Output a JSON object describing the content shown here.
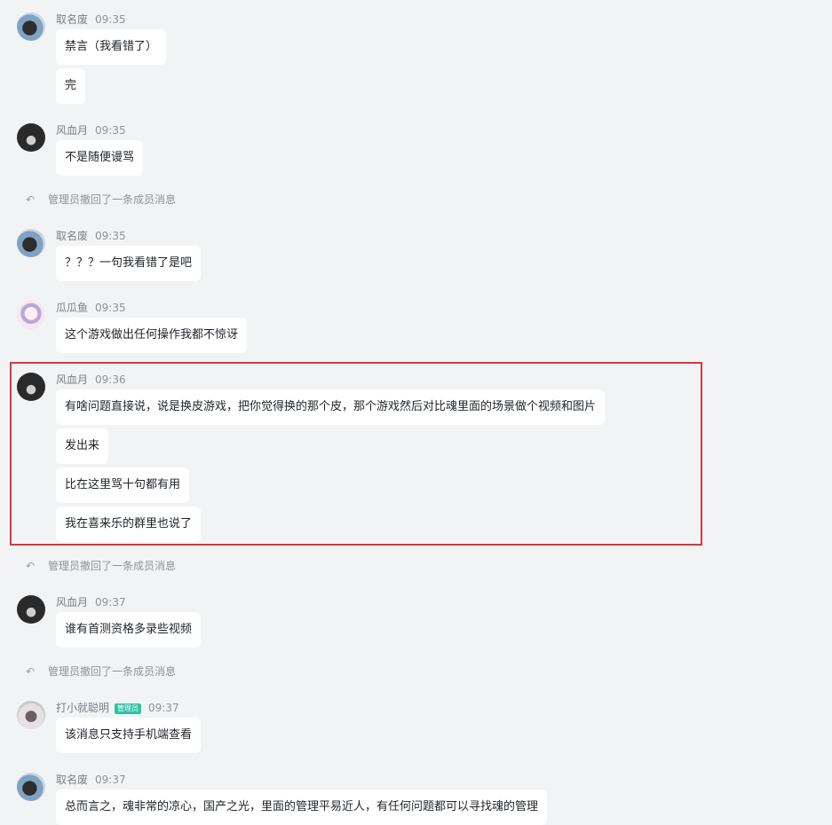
{
  "messages": [
    {
      "sender": "取名废",
      "time": "09:35",
      "bubbles": [
        "禁言（我看错了）",
        "完"
      ]
    },
    {
      "sender": "风血月",
      "time": "09:35",
      "bubbles": [
        "不是随便谩骂"
      ]
    },
    {
      "sender": "取名废",
      "time": "09:35",
      "bubbles": [
        "？？？一句我看错了是吧"
      ]
    },
    {
      "sender": "瓜瓜鱼",
      "time": "09:35",
      "bubbles": [
        "这个游戏做出任何操作我都不惊讶"
      ]
    },
    {
      "sender": "风血月",
      "time": "09:36",
      "bubbles": [
        "有啥问题直接说，说是换皮游戏，把你觉得换的那个皮，那个游戏然后对比魂里面的场景做个视频和图片",
        "发出来",
        "比在这里骂十句都有用",
        "我在喜来乐的群里也说了"
      ]
    },
    {
      "sender": "风血月",
      "time": "09:37",
      "bubbles": [
        "谁有首测资格多录些视频"
      ]
    },
    {
      "sender": "打小就聪明",
      "badge": "管理员",
      "time": "09:37",
      "bubbles": [
        "该消息只支持手机端查看"
      ]
    },
    {
      "sender": "取名废",
      "time": "09:37",
      "bubbles": [
        "总而言之，魂非常的凉心，国产之光，里面的管理平易近人，有任何问题都可以寻找魂的管理"
      ]
    }
  ],
  "notices": [
    "管理员撤回了一条成员消息",
    "管理员撤回了一条成员消息",
    "管理员撤回了一条成员消息"
  ],
  "icons": {
    "avatar": "user-avatar-icon",
    "notice": "undo-arrow-icon"
  },
  "colors": {
    "background": "#f2f3f5",
    "bubble": "#ffffff",
    "highlight": "#d9383a",
    "admin_badge": "#2fc3a5"
  }
}
